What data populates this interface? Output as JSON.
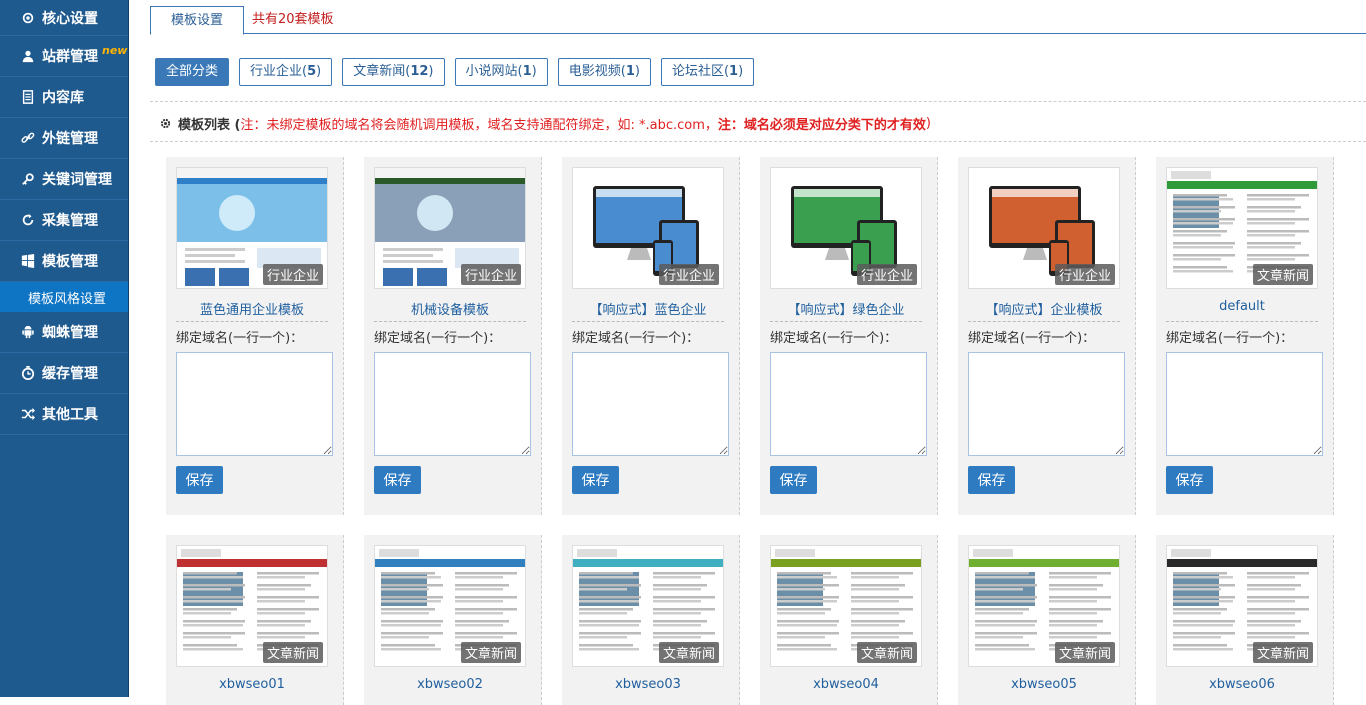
{
  "sidebar": {
    "items": [
      {
        "label": "核心设置",
        "icon": "gear-icon"
      },
      {
        "label": "站群管理",
        "icon": "user-icon",
        "badge": "new"
      },
      {
        "label": "内容库",
        "icon": "document-icon"
      },
      {
        "label": "外链管理",
        "icon": "link-icon"
      },
      {
        "label": "关键词管理",
        "icon": "key-icon"
      },
      {
        "label": "采集管理",
        "icon": "refresh-icon"
      },
      {
        "label": "模板管理",
        "icon": "windows-icon"
      }
    ],
    "active_sub": "模板风格设置",
    "items_after": [
      {
        "label": "蜘蛛管理",
        "icon": "android-icon"
      },
      {
        "label": "缓存管理",
        "icon": "clock-icon"
      },
      {
        "label": "其他工具",
        "icon": "shuffle-icon"
      }
    ]
  },
  "tabs": {
    "active": "模板设置",
    "count": "共有20套模板"
  },
  "categories": [
    {
      "label": "全部分类",
      "count": ""
    },
    {
      "label": "行业企业",
      "count": "5"
    },
    {
      "label": "文章新闻",
      "count": "12"
    },
    {
      "label": "小说网站",
      "count": "1"
    },
    {
      "label": "电影视频",
      "count": "1"
    },
    {
      "label": "论坛社区",
      "count": "1"
    }
  ],
  "list": {
    "title": "模板列表 (",
    "note": "注：未绑定模板的域名将会随机调用模板，域名支持通配符绑定，如: *.abc.com，",
    "note_bold": "注：域名必须是对应分类下的才有效",
    "close": ")"
  },
  "bind_label": "绑定域名(一行一个)：",
  "save_label": "保存",
  "templates": [
    {
      "name": "蓝色通用企业模板",
      "category": "行业企业"
    },
    {
      "name": "机械设备模板",
      "category": "行业企业"
    },
    {
      "name": "【响应式】蓝色企业",
      "category": "行业企业"
    },
    {
      "name": "【响应式】绿色企业",
      "category": "行业企业"
    },
    {
      "name": "【响应式】企业模板",
      "category": "行业企业"
    },
    {
      "name": "default",
      "category": "文章新闻"
    },
    {
      "name": "xbwseo01",
      "category": "文章新闻"
    },
    {
      "name": "xbwseo02",
      "category": "文章新闻"
    },
    {
      "name": "xbwseo03",
      "category": "文章新闻"
    },
    {
      "name": "xbwseo04",
      "category": "文章新闻"
    },
    {
      "name": "xbwseo05",
      "category": "文章新闻"
    },
    {
      "name": "xbwseo06",
      "category": "文章新闻"
    }
  ],
  "colors": {
    "sidebar": "#1f5a8f",
    "accent": "#2e7bc2",
    "warning": "#e02020"
  }
}
